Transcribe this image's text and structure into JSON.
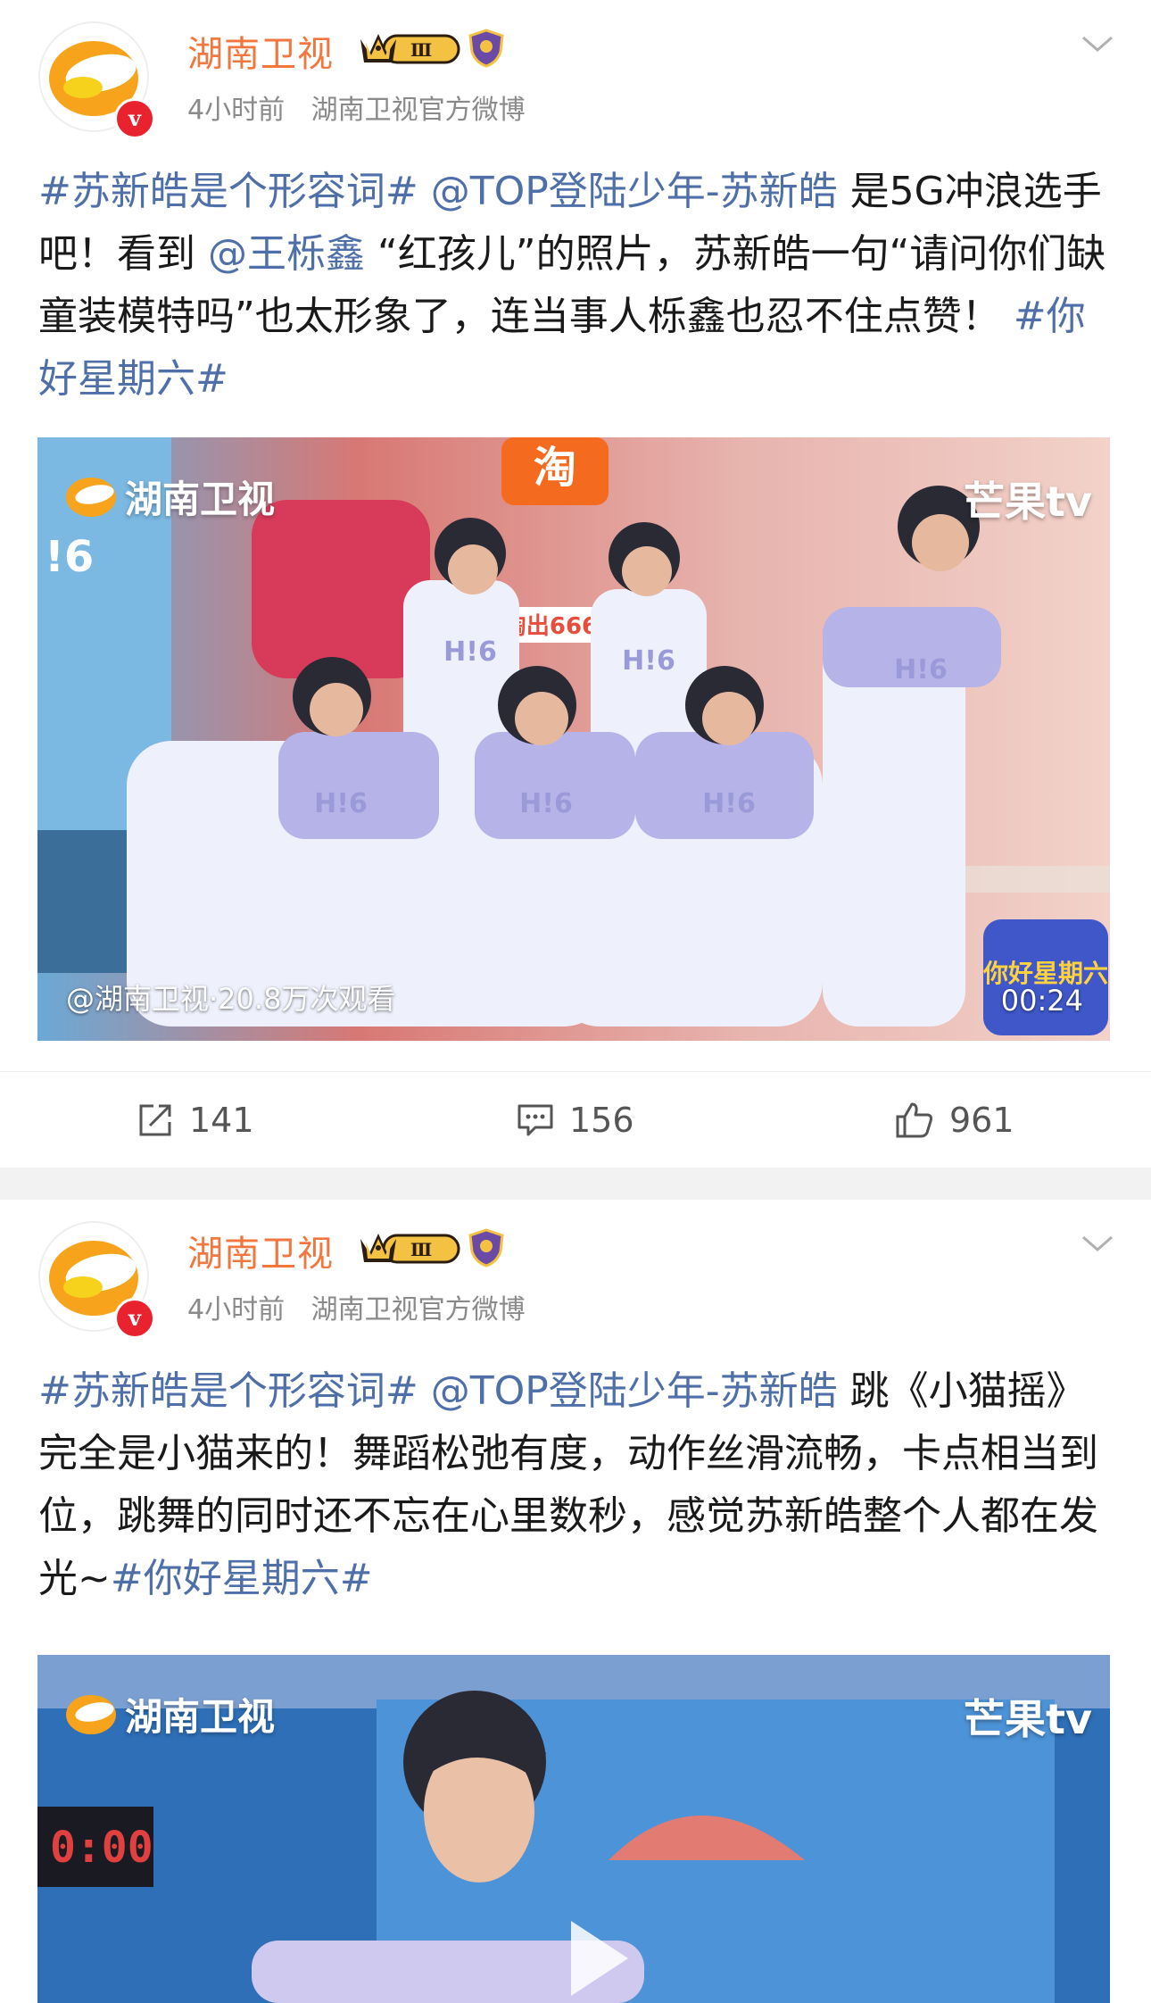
{
  "colors": {
    "username": "#f1773e",
    "link": "#4f6fa8",
    "meta": "#8a8a8a",
    "verified": "#e8232f",
    "separator": "#f2f2f2"
  },
  "posts": [
    {
      "author": "湖南卫视",
      "verified_icon": "v-verified-icon",
      "level_badge": "Ⅲ",
      "time": "4小时前",
      "source": "湖南卫视官方微博",
      "text_parts": [
        {
          "t": "#苏新皓是个形容词#",
          "link": true
        },
        {
          "t": " ",
          "link": false
        },
        {
          "t": "@TOP登陆少年-苏新皓",
          "link": true
        },
        {
          "t": " 是5G冲浪选手吧！看到 ",
          "link": false
        },
        {
          "t": "@王栎鑫",
          "link": true
        },
        {
          "t": " “红孩儿”的照片，苏新皓一句“请问你们缺童装模特吗”也太形象了，连当事人栎鑫也忍不住点赞！ ",
          "link": false
        },
        {
          "t": "#你好星期六#",
          "link": true
        }
      ],
      "video": {
        "watermark_left": "湖南卫视",
        "watermark_right": "芒果tv",
        "caption": "@湖南卫视·20.8万次观看",
        "duration": "00:24",
        "scene_texts": {
          "jersey": "H!6",
          "store": "淘",
          "promo": "淘出666",
          "show": "你好星期六",
          "side": "!6"
        }
      },
      "stats": {
        "reposts": "141",
        "comments": "156",
        "likes": "961"
      }
    },
    {
      "author": "湖南卫视",
      "verified_icon": "v-verified-icon",
      "level_badge": "Ⅲ",
      "time": "4小时前",
      "source": "湖南卫视官方微博",
      "text_parts": [
        {
          "t": "#苏新皓是个形容词#",
          "link": true
        },
        {
          "t": " ",
          "link": false
        },
        {
          "t": "@TOP登陆少年-苏新皓",
          "link": true
        },
        {
          "t": " 跳《小猫摇》完全是小猫来的！舞蹈松弛有度，动作丝滑流畅，卡点相当到位，跳舞的同时还不忘在心里数秒，感觉苏新皓整个人都在发光~",
          "link": false
        },
        {
          "t": "#你好星期六#",
          "link": true
        }
      ],
      "video": {
        "watermark_left": "湖南卫视",
        "watermark_right": "芒果tv",
        "scene_texts": {
          "timer": "0:00"
        }
      }
    }
  ]
}
